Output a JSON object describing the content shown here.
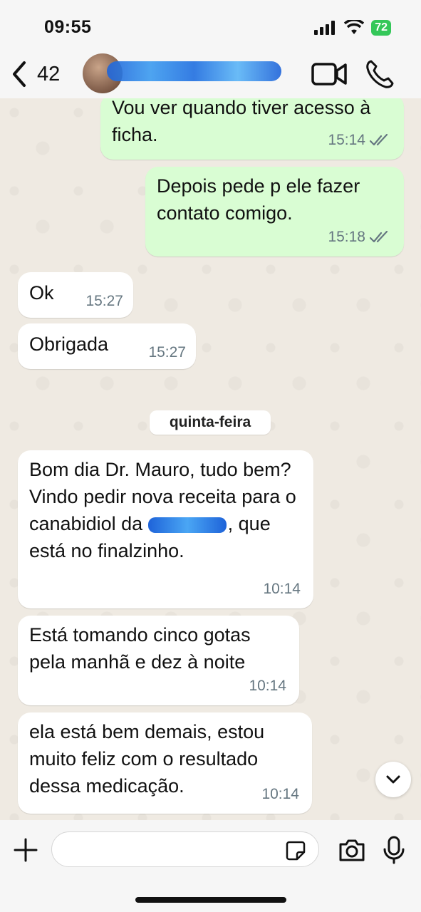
{
  "status_bar": {
    "time": "09:55",
    "battery": "72"
  },
  "header": {
    "back_count": "42"
  },
  "messages": [
    {
      "text": "Vou ver quando tiver acesso à ficha.",
      "time": "15:14"
    },
    {
      "text": "Depois pede p ele fazer contato comigo.",
      "time": "15:18"
    },
    {
      "text": "Ok",
      "time": "15:27"
    },
    {
      "text": "Obrigada",
      "time": "15:27"
    },
    {
      "text_before": "Bom dia Dr. Mauro, tudo bem? Vindo pedir nova receita para o canabidiol da",
      "text_after": ", que está no finalzinho.",
      "time": "10:14"
    },
    {
      "text": "Está tomando cinco gotas pela manhã e dez à noite",
      "time": "10:14"
    },
    {
      "text": "ela está bem demais, estou muito feliz com o resultado dessa medicação.",
      "time": "10:14"
    }
  ],
  "date_separator": "quinta-feira",
  "input": {
    "placeholder": ""
  },
  "colors": {
    "outgoing": "#d9fdd3",
    "incoming": "#ffffff",
    "background": "#efeae2"
  }
}
